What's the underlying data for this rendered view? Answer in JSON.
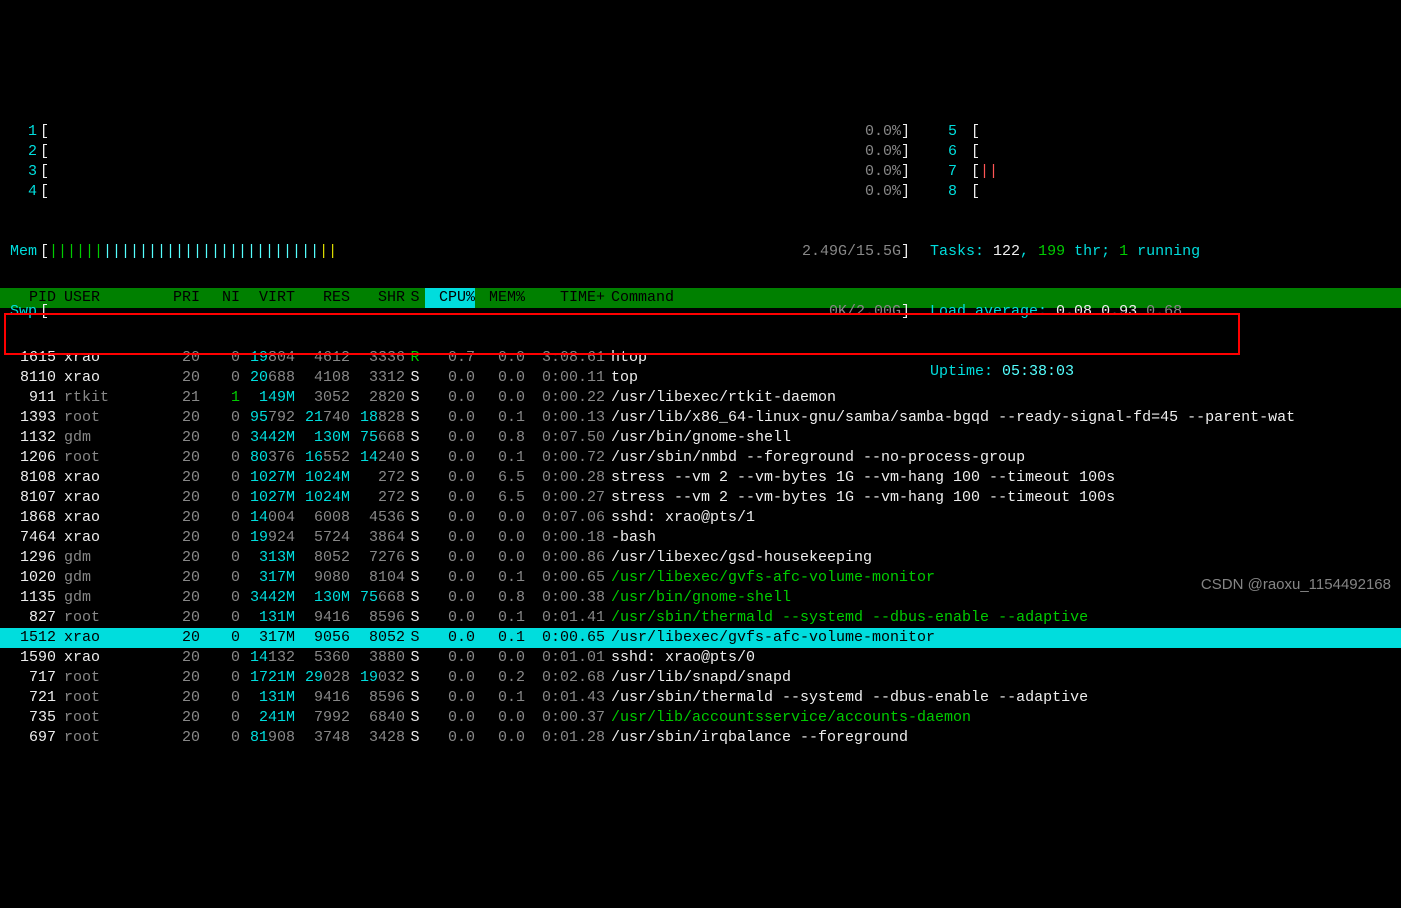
{
  "meters": {
    "cpus_left": [
      {
        "id": "1",
        "pct": "0.0%"
      },
      {
        "id": "2",
        "pct": "0.0%"
      },
      {
        "id": "3",
        "pct": "0.0%"
      },
      {
        "id": "4",
        "pct": "0.0%"
      }
    ],
    "cpus_right": [
      {
        "id": "5",
        "pct": ""
      },
      {
        "id": "6",
        "pct": ""
      },
      {
        "id": "7",
        "pct": ""
      },
      {
        "id": "8",
        "pct": ""
      }
    ],
    "mem": {
      "label": "Mem",
      "value": "2.49G/15.5G"
    },
    "swp": {
      "label": "Swp",
      "value": "0K/2.00G"
    },
    "tasks": {
      "label": "Tasks:",
      "total": "122",
      "thr": "199",
      "thr_label": "thr;",
      "running": "1",
      "running_label": "running"
    },
    "load": {
      "label": "Load average:",
      "v1": "0.08",
      "v2": "0.93",
      "v3": "0.68"
    },
    "uptime": {
      "label": "Uptime:",
      "value": "05:38:03"
    }
  },
  "columns": [
    "PID",
    "USER",
    "PRI",
    "NI",
    "VIRT",
    "RES",
    "SHR",
    "S",
    "CPU%",
    "MEM%",
    "TIME+",
    "Command"
  ],
  "sort_col": "CPU%",
  "processes": [
    {
      "pid": "1615",
      "user": "xrao",
      "user_c": "white",
      "pri": "20",
      "ni": "0",
      "virt": "19804",
      "res": "4612",
      "shr": "3336",
      "s": "R",
      "s_c": "green",
      "cpu": "0.7",
      "mem": "0.0",
      "time": "3:08.61",
      "cmd": "htop",
      "cmd_c": "white",
      "sel": false
    },
    {
      "pid": "8110",
      "user": "xrao",
      "user_c": "white",
      "pri": "20",
      "ni": "0",
      "virt": "20688",
      "res": "4108",
      "shr": "3312",
      "s": "S",
      "s_c": "white",
      "cpu": "0.0",
      "mem": "0.0",
      "time": "0:00.11",
      "cmd": "top",
      "cmd_c": "white",
      "sel": false
    },
    {
      "pid": "911",
      "user": "rtkit",
      "user_c": "gray",
      "pri": "21",
      "ni": "1",
      "ni_c": "green",
      "virt": "149M",
      "res": "3052",
      "shr": "2820",
      "s": "S",
      "s_c": "white",
      "cpu": "0.0",
      "mem": "0.0",
      "time": "0:00.22",
      "cmd": "/usr/libexec/rtkit-daemon",
      "cmd_c": "white",
      "sel": false
    },
    {
      "pid": "1393",
      "user": "root",
      "user_c": "gray",
      "pri": "20",
      "ni": "0",
      "virt": "95792",
      "res": "21740",
      "shr": "18828",
      "s": "S",
      "s_c": "white",
      "cpu": "0.0",
      "mem": "0.1",
      "time": "0:00.13",
      "cmd": "/usr/lib/x86_64-linux-gnu/samba/samba-bgqd --ready-signal-fd=45 --parent-wat",
      "cmd_c": "white",
      "sel": false
    },
    {
      "pid": "1132",
      "user": "gdm",
      "user_c": "gray",
      "pri": "20",
      "ni": "0",
      "virt": "3442M",
      "res": "130M",
      "shr": "75668",
      "s": "S",
      "s_c": "white",
      "cpu": "0.0",
      "mem": "0.8",
      "time": "0:07.50",
      "cmd": "/usr/bin/gnome-shell",
      "cmd_c": "white",
      "sel": false
    },
    {
      "pid": "1206",
      "user": "root",
      "user_c": "gray",
      "pri": "20",
      "ni": "0",
      "virt": "80376",
      "res": "16552",
      "shr": "14240",
      "s": "S",
      "s_c": "white",
      "cpu": "0.0",
      "mem": "0.1",
      "time": "0:00.72",
      "cmd": "/usr/sbin/nmbd --foreground --no-process-group",
      "cmd_c": "white",
      "sel": false
    },
    {
      "pid": "8108",
      "user": "xrao",
      "user_c": "white",
      "pri": "20",
      "ni": "0",
      "virt": "1027M",
      "res": "1024M",
      "shr": "272",
      "s": "S",
      "s_c": "white",
      "cpu": "0.0",
      "mem": "6.5",
      "time": "0:00.28",
      "cmd": "stress --vm 2 --vm-bytes 1G --vm-hang 100 --timeout 100s",
      "cmd_c": "white",
      "sel": false
    },
    {
      "pid": "8107",
      "user": "xrao",
      "user_c": "white",
      "pri": "20",
      "ni": "0",
      "virt": "1027M",
      "res": "1024M",
      "shr": "272",
      "s": "S",
      "s_c": "white",
      "cpu": "0.0",
      "mem": "6.5",
      "time": "0:00.27",
      "cmd": "stress --vm 2 --vm-bytes 1G --vm-hang 100 --timeout 100s",
      "cmd_c": "white",
      "sel": false
    },
    {
      "pid": "1868",
      "user": "xrao",
      "user_c": "white",
      "pri": "20",
      "ni": "0",
      "virt": "14004",
      "res": "6008",
      "shr": "4536",
      "s": "S",
      "s_c": "white",
      "cpu": "0.0",
      "mem": "0.0",
      "time": "0:07.06",
      "cmd": "sshd: xrao@pts/1",
      "cmd_c": "white",
      "sel": false
    },
    {
      "pid": "7464",
      "user": "xrao",
      "user_c": "white",
      "pri": "20",
      "ni": "0",
      "virt": "19924",
      "res": "5724",
      "shr": "3864",
      "s": "S",
      "s_c": "white",
      "cpu": "0.0",
      "mem": "0.0",
      "time": "0:00.18",
      "cmd": "-bash",
      "cmd_c": "white",
      "sel": false
    },
    {
      "pid": "1296",
      "user": "gdm",
      "user_c": "gray",
      "pri": "20",
      "ni": "0",
      "virt": "313M",
      "res": "8052",
      "shr": "7276",
      "s": "S",
      "s_c": "white",
      "cpu": "0.0",
      "mem": "0.0",
      "time": "0:00.86",
      "cmd": "/usr/libexec/gsd-housekeeping",
      "cmd_c": "white",
      "sel": false
    },
    {
      "pid": "1020",
      "user": "gdm",
      "user_c": "gray",
      "pri": "20",
      "ni": "0",
      "virt": "317M",
      "res": "9080",
      "shr": "8104",
      "s": "S",
      "s_c": "white",
      "cpu": "0.0",
      "mem": "0.1",
      "time": "0:00.65",
      "cmd": "/usr/libexec/gvfs-afc-volume-monitor",
      "cmd_c": "green",
      "sel": false
    },
    {
      "pid": "1135",
      "user": "gdm",
      "user_c": "gray",
      "pri": "20",
      "ni": "0",
      "virt": "3442M",
      "res": "130M",
      "shr": "75668",
      "s": "S",
      "s_c": "white",
      "cpu": "0.0",
      "mem": "0.8",
      "time": "0:00.38",
      "cmd": "/usr/bin/gnome-shell",
      "cmd_c": "green",
      "sel": false
    },
    {
      "pid": "827",
      "user": "root",
      "user_c": "gray",
      "pri": "20",
      "ni": "0",
      "virt": "131M",
      "res": "9416",
      "shr": "8596",
      "s": "S",
      "s_c": "white",
      "cpu": "0.0",
      "mem": "0.1",
      "time": "0:01.41",
      "cmd": "/usr/sbin/thermald --systemd --dbus-enable --adaptive",
      "cmd_c": "green",
      "sel": false
    },
    {
      "pid": "1512",
      "user": "xrao",
      "user_c": "",
      "pri": "20",
      "ni": "0",
      "virt": "317M",
      "res": "9056",
      "shr": "8052",
      "s": "S",
      "s_c": "",
      "cpu": "0.0",
      "mem": "0.1",
      "time": "0:00.65",
      "cmd": "/usr/libexec/gvfs-afc-volume-monitor",
      "cmd_c": "",
      "sel": true
    },
    {
      "pid": "1590",
      "user": "xrao",
      "user_c": "white",
      "pri": "20",
      "ni": "0",
      "virt": "14132",
      "res": "5360",
      "shr": "3880",
      "s": "S",
      "s_c": "white",
      "cpu": "0.0",
      "mem": "0.0",
      "time": "0:01.01",
      "cmd": "sshd: xrao@pts/0",
      "cmd_c": "white",
      "sel": false
    },
    {
      "pid": "717",
      "user": "root",
      "user_c": "gray",
      "pri": "20",
      "ni": "0",
      "virt": "1721M",
      "res": "29028",
      "shr": "19032",
      "s": "S",
      "s_c": "white",
      "cpu": "0.0",
      "mem": "0.2",
      "time": "0:02.68",
      "cmd": "/usr/lib/snapd/snapd",
      "cmd_c": "white",
      "sel": false
    },
    {
      "pid": "721",
      "user": "root",
      "user_c": "gray",
      "pri": "20",
      "ni": "0",
      "virt": "131M",
      "res": "9416",
      "shr": "8596",
      "s": "S",
      "s_c": "white",
      "cpu": "0.0",
      "mem": "0.1",
      "time": "0:01.43",
      "cmd": "/usr/sbin/thermald --systemd --dbus-enable --adaptive",
      "cmd_c": "white",
      "sel": false
    },
    {
      "pid": "735",
      "user": "root",
      "user_c": "gray",
      "pri": "20",
      "ni": "0",
      "virt": "241M",
      "res": "7992",
      "shr": "6840",
      "s": "S",
      "s_c": "white",
      "cpu": "0.0",
      "mem": "0.0",
      "time": "0:00.37",
      "cmd": "/usr/lib/accountsservice/accounts-daemon",
      "cmd_c": "green",
      "sel": false
    },
    {
      "pid": "697",
      "user": "root",
      "user_c": "gray",
      "pri": "20",
      "ni": "0",
      "virt": "81908",
      "res": "3748",
      "shr": "3428",
      "s": "S",
      "s_c": "white",
      "cpu": "0.0",
      "mem": "0.0",
      "time": "0:01.28",
      "cmd": "/usr/sbin/irqbalance --foreground",
      "cmd_c": "white",
      "sel": false
    }
  ],
  "watermark": "CSDN @raoxu_1154492168"
}
